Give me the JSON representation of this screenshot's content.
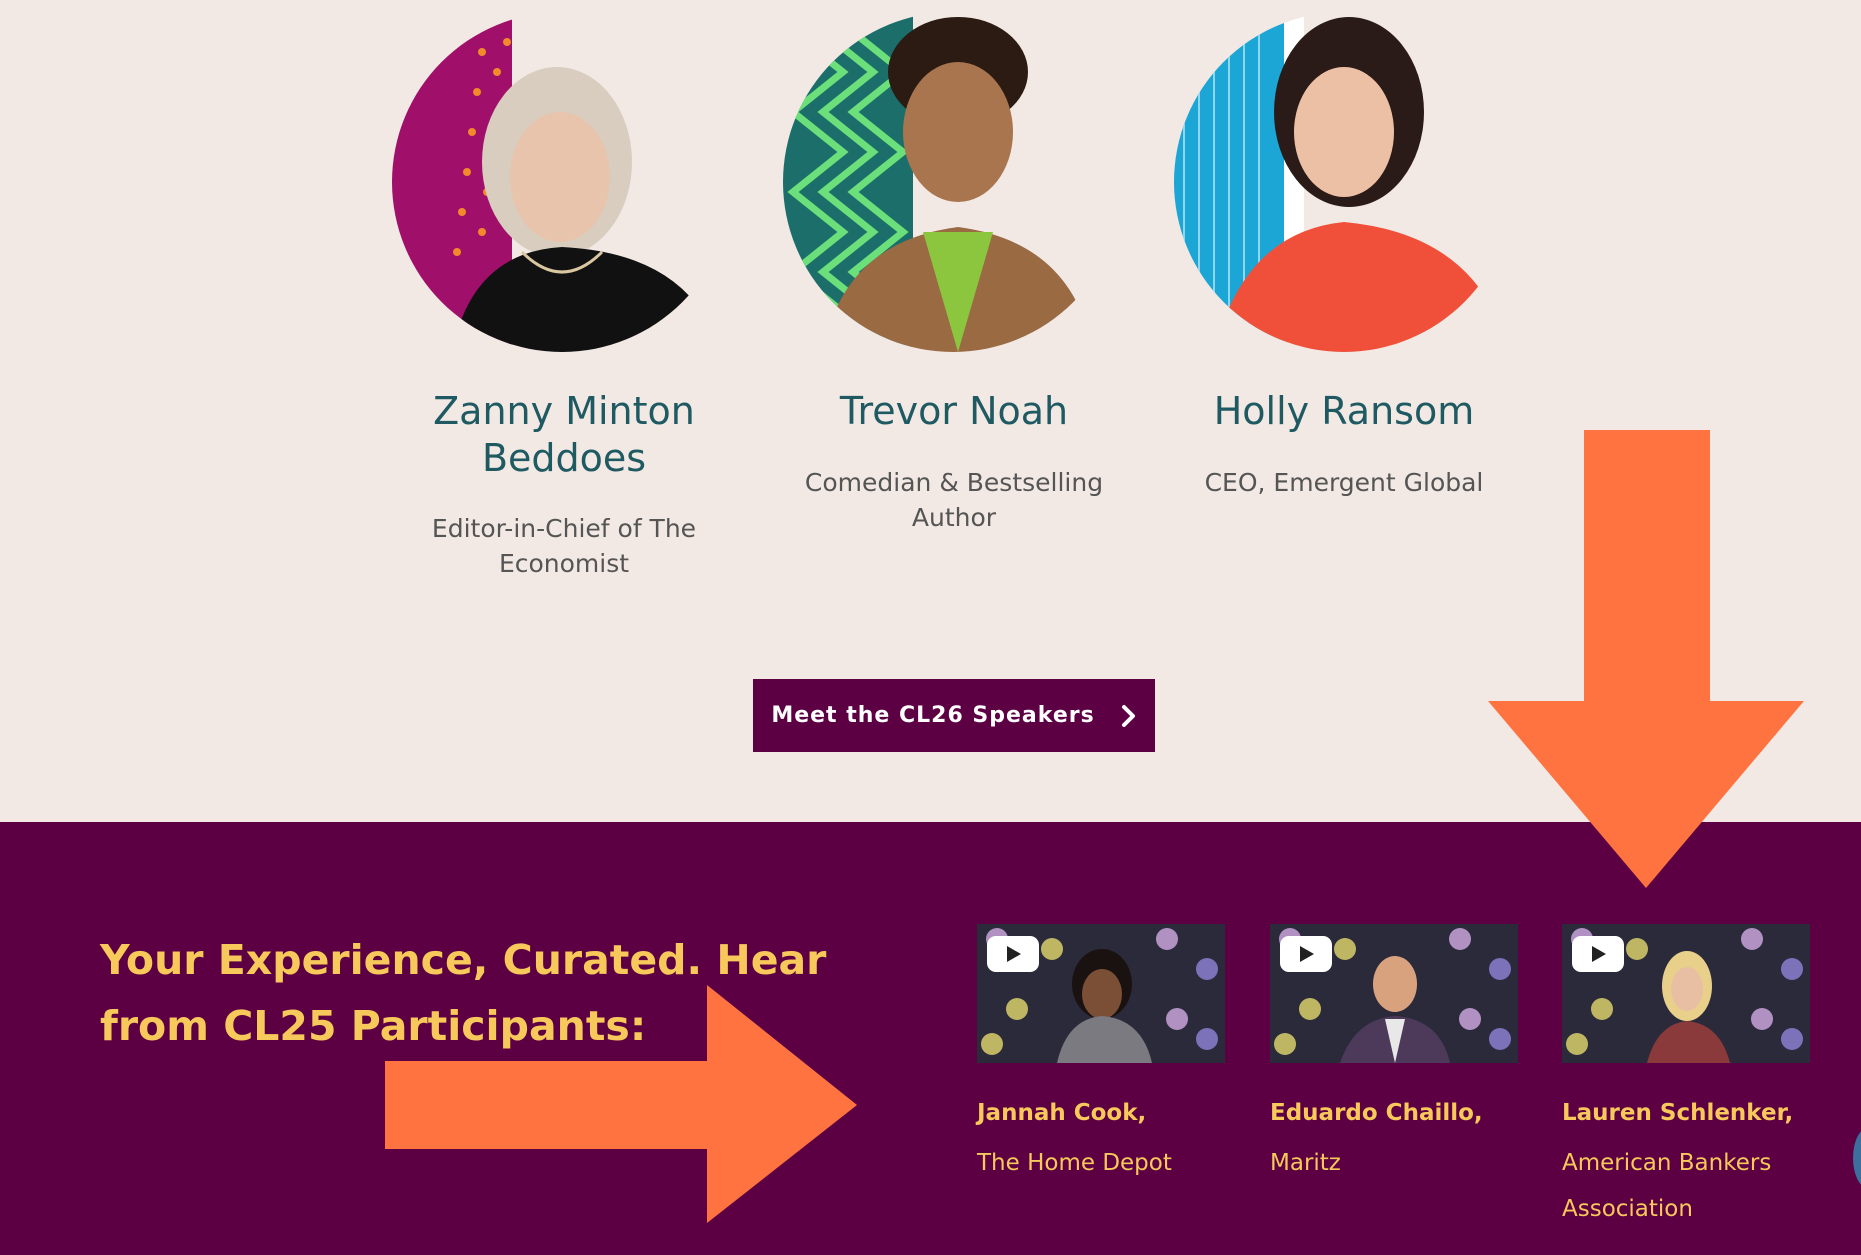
{
  "speakers": [
    {
      "name": "Zanny Minton Beddoes",
      "role": "Editor-in-Chief of The Economist"
    },
    {
      "name": "Trevor Noah",
      "role": "Comedian & Bestselling Author"
    },
    {
      "name": "Holly Ransom",
      "role": "CEO, Emergent Global"
    }
  ],
  "cta": {
    "label": "Meet the CL26 Speakers"
  },
  "participants_section": {
    "headline": "Your Experience, Curated. Hear from CL25 Participants:",
    "videos": [
      {
        "name": "Jannah Cook,",
        "org": "The Home Depot"
      },
      {
        "name": "Eduardo Chaillo,",
        "org": "Maritz"
      },
      {
        "name": "Lauren Schlenker,",
        "org": "American Bankers Association"
      }
    ]
  },
  "colors": {
    "background": "#f2e9e4",
    "brand_purple": "#5c0043",
    "accent_yellow": "#f7c85a",
    "arrow_orange": "#ff7340",
    "speaker_name_teal": "#1f5a63"
  },
  "icons": [
    "play-icon",
    "chevron-right-icon",
    "arrow-right-annotation",
    "arrow-down-annotation"
  ]
}
